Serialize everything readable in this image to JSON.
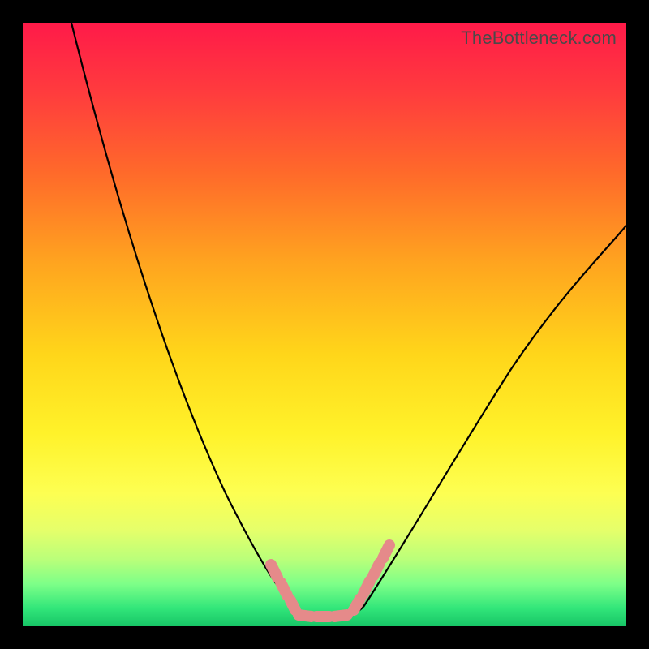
{
  "watermark": "TheBottleneck.com",
  "colors": {
    "background": "#000000",
    "curve": "#000000",
    "marker": "#e58a8a"
  },
  "chart_data": {
    "type": "line",
    "title": "",
    "xlabel": "",
    "ylabel": "",
    "xlim": [
      0,
      100
    ],
    "ylim": [
      0,
      100
    ],
    "series": [
      {
        "name": "left-curve",
        "x": [
          8,
          12,
          16,
          20,
          24,
          27,
          30,
          33,
          36,
          38,
          40,
          42,
          44,
          46
        ],
        "values": [
          100,
          88,
          76,
          64,
          52,
          42,
          33,
          25,
          18,
          12,
          8,
          5,
          3,
          2
        ]
      },
      {
        "name": "right-curve",
        "x": [
          54,
          56,
          59,
          63,
          68,
          74,
          81,
          88,
          95,
          100
        ],
        "values": [
          2,
          4,
          8,
          14,
          22,
          32,
          42,
          52,
          61,
          67
        ]
      },
      {
        "name": "bottom-segment",
        "x": [
          40,
          45,
          50,
          55
        ],
        "values": [
          0,
          0,
          0,
          0
        ]
      }
    ],
    "markers": [
      {
        "series": "left-curve",
        "x": 40,
        "y": 8
      },
      {
        "series": "left-curve",
        "x": 42,
        "y": 5
      },
      {
        "series": "left-curve",
        "x": 44,
        "y": 3
      },
      {
        "series": "left-curve",
        "x": 46,
        "y": 2
      },
      {
        "series": "bottom-segment",
        "x": 45,
        "y": 0
      },
      {
        "series": "bottom-segment",
        "x": 50,
        "y": 0
      },
      {
        "series": "bottom-segment",
        "x": 55,
        "y": 0
      },
      {
        "series": "right-curve",
        "x": 54,
        "y": 2
      },
      {
        "series": "right-curve",
        "x": 56,
        "y": 4
      },
      {
        "series": "right-curve",
        "x": 58,
        "y": 7
      },
      {
        "series": "right-curve",
        "x": 60,
        "y": 10
      }
    ]
  }
}
